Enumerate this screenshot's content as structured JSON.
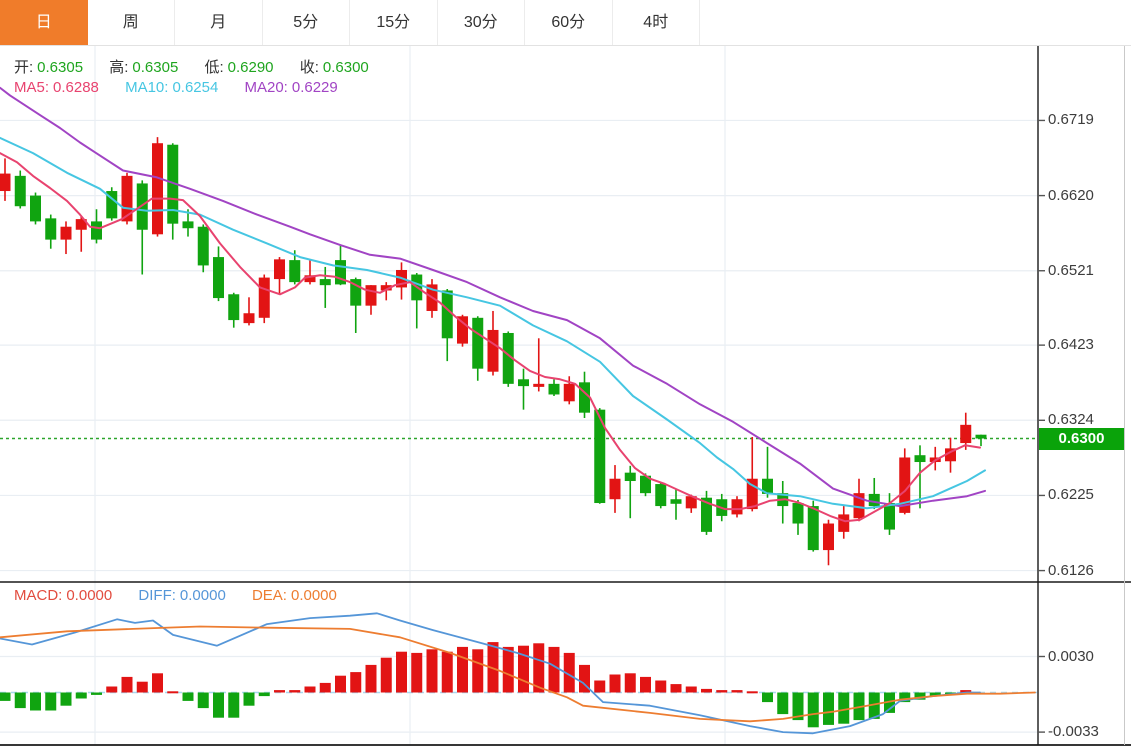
{
  "tabs": {
    "items": [
      {
        "key": "day",
        "label": "日",
        "active": true
      },
      {
        "key": "week",
        "label": "周",
        "active": false
      },
      {
        "key": "month",
        "label": "月",
        "active": false
      },
      {
        "key": "5min",
        "label": "5分",
        "active": false
      },
      {
        "key": "15min",
        "label": "15分",
        "active": false
      },
      {
        "key": "30min",
        "label": "30分",
        "active": false
      },
      {
        "key": "60min",
        "label": "60分",
        "active": false
      },
      {
        "key": "4hour",
        "label": "4时",
        "active": false
      }
    ]
  },
  "legend": {
    "open_label": "开:",
    "open": "0.6305",
    "high_label": "高:",
    "high": "0.6305",
    "low_label": "低:",
    "low": "0.6290",
    "close_label": "收:",
    "close": "0.6300",
    "ma5_label": "MA5:",
    "ma5": "0.6288",
    "ma10_label": "MA10:",
    "ma10": "0.6254",
    "ma20_label": "MA20:",
    "ma20": "0.6229"
  },
  "macd_legend": {
    "macd_label": "MACD:",
    "macd": "0.0000",
    "diff_label": "DIFF:",
    "diff": "0.0000",
    "dea_label": "DEA:",
    "dea": "0.0000"
  },
  "price_axis": {
    "ticks": [
      {
        "label": "0.6719",
        "value": 0.6719
      },
      {
        "label": "0.6620",
        "value": 0.662
      },
      {
        "label": "0.6521",
        "value": 0.6521
      },
      {
        "label": "0.6423",
        "value": 0.6423
      },
      {
        "label": "0.6324",
        "value": 0.6324
      },
      {
        "label": "0.6225",
        "value": 0.6225
      },
      {
        "label": "0.6126",
        "value": 0.6126
      }
    ],
    "current": "0.6300",
    "current_value": 0.63
  },
  "macd_axis": {
    "ticks": [
      {
        "label": "0.0030",
        "value": 0.003
      },
      {
        "label": "-0.0033",
        "value": -0.0033
      }
    ]
  },
  "colors": {
    "up": "#e21414",
    "down": "#10a410",
    "ma5": "#e8436f",
    "ma10": "#46c6e2",
    "ma20": "#a144c4",
    "diff": "#5596d8",
    "dea": "#ed7d31",
    "macd_text": "#e24c3f",
    "tab_accent": "#f07c2a",
    "badge": "#0aa30a",
    "value_green": "#1fa51f",
    "price_line": "#2ca52c",
    "zero_line": "#a8d8f0",
    "grid": "#e9eef3",
    "panel_border": "#1a1a1a",
    "axis_text": "#3c3c3c"
  },
  "chart_data": {
    "type": "candlestick",
    "panels": [
      "price",
      "macd"
    ],
    "convention": "red-up-green-down",
    "price_axis_range": [
      0.609,
      0.679
    ],
    "macd_axis_range": [
      -0.0044,
      0.0094
    ],
    "current_price": 0.63,
    "candles": [
      [
        0.6626,
        0.6669,
        0.6613,
        0.6649
      ],
      [
        0.6646,
        0.6653,
        0.6603,
        0.6606
      ],
      [
        0.662,
        0.6624,
        0.6582,
        0.6586
      ],
      [
        0.659,
        0.6595,
        0.655,
        0.6562
      ],
      [
        0.6562,
        0.6586,
        0.6543,
        0.6579
      ],
      [
        0.6575,
        0.6593,
        0.6546,
        0.6589
      ],
      [
        0.6586,
        0.6602,
        0.6557,
        0.6562
      ],
      [
        0.6626,
        0.6631,
        0.6587,
        0.659
      ],
      [
        0.6586,
        0.665,
        0.6582,
        0.6646
      ],
      [
        0.6636,
        0.664,
        0.6516,
        0.6575
      ],
      [
        0.6569,
        0.6697,
        0.6566,
        0.6689
      ],
      [
        0.6687,
        0.6689,
        0.6562,
        0.6583
      ],
      [
        0.6586,
        0.6602,
        0.6566,
        0.6577
      ],
      [
        0.6579,
        0.6582,
        0.6519,
        0.6528
      ],
      [
        0.6539,
        0.6553,
        0.6481,
        0.6485
      ],
      [
        0.649,
        0.6492,
        0.6446,
        0.6456
      ],
      [
        0.6452,
        0.6486,
        0.6449,
        0.6465
      ],
      [
        0.6459,
        0.6516,
        0.6452,
        0.6512
      ],
      [
        0.651,
        0.6539,
        0.649,
        0.6536
      ],
      [
        0.6535,
        0.6548,
        0.6503,
        0.6506
      ],
      [
        0.6506,
        0.6536,
        0.6503,
        0.6515
      ],
      [
        0.651,
        0.6526,
        0.6472,
        0.6502
      ],
      [
        0.6535,
        0.6555,
        0.6502,
        0.6503
      ],
      [
        0.651,
        0.6512,
        0.6439,
        0.6475
      ],
      [
        0.6475,
        0.6502,
        0.6463,
        0.6502
      ],
      [
        0.6495,
        0.6506,
        0.6482,
        0.6502
      ],
      [
        0.6499,
        0.6532,
        0.6483,
        0.6522
      ],
      [
        0.6516,
        0.6518,
        0.6445,
        0.6482
      ],
      [
        0.6468,
        0.651,
        0.6459,
        0.6503
      ],
      [
        0.6495,
        0.6497,
        0.6402,
        0.6432
      ],
      [
        0.6425,
        0.6463,
        0.6421,
        0.6461
      ],
      [
        0.6459,
        0.6461,
        0.6376,
        0.6392
      ],
      [
        0.6388,
        0.6468,
        0.6383,
        0.6443
      ],
      [
        0.6439,
        0.6441,
        0.6368,
        0.6372
      ],
      [
        0.6378,
        0.6392,
        0.6338,
        0.6369
      ],
      [
        0.6368,
        0.6432,
        0.6362,
        0.6372
      ],
      [
        0.6372,
        0.6378,
        0.6356,
        0.6358
      ],
      [
        0.6349,
        0.6382,
        0.6345,
        0.6372
      ],
      [
        0.6374,
        0.6388,
        0.6327,
        0.6334
      ],
      [
        0.6338,
        0.634,
        0.6214,
        0.6215
      ],
      [
        0.622,
        0.6265,
        0.6202,
        0.6247
      ],
      [
        0.6255,
        0.6264,
        0.6195,
        0.6244
      ],
      [
        0.6251,
        0.6254,
        0.6224,
        0.6228
      ],
      [
        0.624,
        0.6242,
        0.6208,
        0.6211
      ],
      [
        0.622,
        0.6234,
        0.6193,
        0.6214
      ],
      [
        0.6208,
        0.6226,
        0.6202,
        0.6224
      ],
      [
        0.6222,
        0.6231,
        0.6173,
        0.6177
      ],
      [
        0.622,
        0.6227,
        0.6191,
        0.6198
      ],
      [
        0.62,
        0.6224,
        0.6196,
        0.622
      ],
      [
        0.6207,
        0.6302,
        0.6204,
        0.6247
      ],
      [
        0.6247,
        0.6289,
        0.6222,
        0.6227
      ],
      [
        0.6228,
        0.6244,
        0.6188,
        0.6211
      ],
      [
        0.6215,
        0.6219,
        0.6173,
        0.6188
      ],
      [
        0.6211,
        0.6218,
        0.6151,
        0.6153
      ],
      [
        0.6153,
        0.6193,
        0.6133,
        0.6188
      ],
      [
        0.6177,
        0.6211,
        0.6168,
        0.62
      ],
      [
        0.6195,
        0.6247,
        0.6191,
        0.6228
      ],
      [
        0.6227,
        0.6248,
        0.6207,
        0.6211
      ],
      [
        0.6215,
        0.6228,
        0.6173,
        0.618
      ],
      [
        0.6202,
        0.6287,
        0.62,
        0.6275
      ],
      [
        0.6278,
        0.6291,
        0.6208,
        0.6269
      ],
      [
        0.6269,
        0.6289,
        0.6258,
        0.6275
      ],
      [
        0.627,
        0.6301,
        0.6255,
        0.6287
      ],
      [
        0.6294,
        0.6334,
        0.6285,
        0.6318
      ],
      [
        0.6305,
        0.6305,
        0.629,
        0.63
      ]
    ],
    "ma5_points": [
      [
        0,
        0.6676
      ],
      [
        17,
        0.6664
      ],
      [
        33,
        0.6646
      ],
      [
        50,
        0.663
      ],
      [
        67,
        0.6613
      ],
      [
        80,
        0.6595
      ],
      [
        90,
        0.6579
      ],
      [
        100,
        0.6577
      ],
      [
        122,
        0.6589
      ],
      [
        152,
        0.6616
      ],
      [
        170,
        0.6616
      ],
      [
        183,
        0.6614
      ],
      [
        200,
        0.6593
      ],
      [
        220,
        0.6557
      ],
      [
        240,
        0.6526
      ],
      [
        260,
        0.6499
      ],
      [
        280,
        0.649
      ],
      [
        295,
        0.6499
      ],
      [
        305,
        0.6512
      ],
      [
        320,
        0.6515
      ],
      [
        335,
        0.6513
      ],
      [
        350,
        0.6506
      ],
      [
        365,
        0.6496
      ],
      [
        380,
        0.6492
      ],
      [
        395,
        0.6502
      ],
      [
        410,
        0.6506
      ],
      [
        425,
        0.6492
      ],
      [
        440,
        0.6479
      ],
      [
        455,
        0.6461
      ],
      [
        470,
        0.6445
      ],
      [
        485,
        0.6432
      ],
      [
        500,
        0.6419
      ],
      [
        515,
        0.6403
      ],
      [
        530,
        0.6389
      ],
      [
        545,
        0.6381
      ],
      [
        560,
        0.6378
      ],
      [
        575,
        0.6372
      ],
      [
        590,
        0.6354
      ],
      [
        605,
        0.6314
      ],
      [
        620,
        0.6285
      ],
      [
        635,
        0.6261
      ],
      [
        650,
        0.6247
      ],
      [
        665,
        0.624
      ],
      [
        680,
        0.6231
      ],
      [
        695,
        0.6222
      ],
      [
        710,
        0.6214
      ],
      [
        725,
        0.6207
      ],
      [
        740,
        0.6207
      ],
      [
        755,
        0.6211
      ],
      [
        770,
        0.6218
      ],
      [
        785,
        0.622
      ],
      [
        800,
        0.6215
      ],
      [
        815,
        0.6207
      ],
      [
        830,
        0.6198
      ],
      [
        845,
        0.6191
      ],
      [
        860,
        0.6193
      ],
      [
        875,
        0.6204
      ],
      [
        890,
        0.6215
      ],
      [
        905,
        0.6231
      ],
      [
        920,
        0.6255
      ],
      [
        935,
        0.6271
      ],
      [
        950,
        0.6282
      ],
      [
        965,
        0.6291
      ],
      [
        980,
        0.6288
      ]
    ],
    "ma10_points": [
      [
        0,
        0.6696
      ],
      [
        33,
        0.6676
      ],
      [
        67,
        0.665
      ],
      [
        100,
        0.6629
      ],
      [
        123,
        0.6604
      ],
      [
        147,
        0.66
      ],
      [
        173,
        0.6601
      ],
      [
        200,
        0.6595
      ],
      [
        233,
        0.6575
      ],
      [
        267,
        0.6557
      ],
      [
        300,
        0.6539
      ],
      [
        333,
        0.6528
      ],
      [
        367,
        0.6522
      ],
      [
        400,
        0.6512
      ],
      [
        433,
        0.6496
      ],
      [
        467,
        0.6486
      ],
      [
        500,
        0.6475
      ],
      [
        533,
        0.6449
      ],
      [
        567,
        0.6428
      ],
      [
        600,
        0.6401
      ],
      [
        633,
        0.6356
      ],
      [
        667,
        0.6325
      ],
      [
        700,
        0.6294
      ],
      [
        717,
        0.6275
      ],
      [
        733,
        0.626
      ],
      [
        750,
        0.624
      ],
      [
        767,
        0.6228
      ],
      [
        800,
        0.6224
      ],
      [
        833,
        0.6214
      ],
      [
        867,
        0.6208
      ],
      [
        900,
        0.6214
      ],
      [
        933,
        0.6224
      ],
      [
        950,
        0.6234
      ],
      [
        967,
        0.6244
      ],
      [
        985,
        0.6258
      ]
    ],
    "ma20_points": [
      [
        0,
        0.6762
      ],
      [
        10,
        0.6752
      ],
      [
        40,
        0.6726
      ],
      [
        60,
        0.6709
      ],
      [
        80,
        0.669
      ],
      [
        95,
        0.6677
      ],
      [
        123,
        0.6653
      ],
      [
        157,
        0.6644
      ],
      [
        190,
        0.6629
      ],
      [
        223,
        0.6613
      ],
      [
        257,
        0.6595
      ],
      [
        290,
        0.6579
      ],
      [
        310,
        0.6569
      ],
      [
        340,
        0.6555
      ],
      [
        370,
        0.6542
      ],
      [
        400,
        0.6537
      ],
      [
        433,
        0.6522
      ],
      [
        467,
        0.6506
      ],
      [
        500,
        0.6486
      ],
      [
        533,
        0.6468
      ],
      [
        567,
        0.6456
      ],
      [
        600,
        0.6432
      ],
      [
        633,
        0.6396
      ],
      [
        667,
        0.6372
      ],
      [
        700,
        0.6345
      ],
      [
        733,
        0.6322
      ],
      [
        767,
        0.6294
      ],
      [
        800,
        0.6267
      ],
      [
        833,
        0.6234
      ],
      [
        867,
        0.6218
      ],
      [
        900,
        0.6211
      ],
      [
        933,
        0.6218
      ],
      [
        967,
        0.6224
      ],
      [
        985,
        0.6231
      ]
    ],
    "macd_hist": [
      -0.0007,
      -0.0013,
      -0.0015,
      -0.0015,
      -0.0011,
      -0.0005,
      -0.0002,
      0.0005,
      0.0013,
      0.0009,
      0.0016,
      0.0001,
      -0.0007,
      -0.0013,
      -0.0021,
      -0.0021,
      -0.0011,
      -0.0003,
      0.0002,
      0.0002,
      0.0005,
      0.0008,
      0.0014,
      0.0017,
      0.0023,
      0.0029,
      0.0034,
      0.0033,
      0.0036,
      0.0034,
      0.0038,
      0.0036,
      0.0042,
      0.0038,
      0.0039,
      0.0041,
      0.0038,
      0.0033,
      0.0023,
      0.001,
      0.0015,
      0.0016,
      0.0013,
      0.001,
      0.0007,
      0.0005,
      0.0003,
      0.0002,
      0.0002,
      0.0001,
      -0.0008,
      -0.0018,
      -0.0023,
      -0.0029,
      -0.0027,
      -0.0026,
      -0.0023,
      -0.0022,
      -0.0017,
      -0.0008,
      -0.0006,
      -0.0003,
      -0.0001,
      0.0002,
      0.0
    ],
    "diff_points": [
      [
        0,
        0.0045
      ],
      [
        32,
        0.004
      ],
      [
        75,
        0.005
      ],
      [
        117,
        0.0061
      ],
      [
        135,
        0.0058
      ],
      [
        153,
        0.006
      ],
      [
        173,
        0.0048
      ],
      [
        217,
        0.0039
      ],
      [
        267,
        0.0057
      ],
      [
        310,
        0.0062
      ],
      [
        350,
        0.0064
      ],
      [
        377,
        0.0066
      ],
      [
        400,
        0.006
      ],
      [
        433,
        0.0052
      ],
      [
        482,
        0.0041
      ],
      [
        517,
        0.0033
      ],
      [
        550,
        0.0024
      ],
      [
        583,
        0.0008
      ],
      [
        603,
        -0.0008
      ],
      [
        650,
        -0.0011
      ],
      [
        700,
        -0.0019
      ],
      [
        750,
        -0.0028
      ],
      [
        783,
        -0.0033
      ],
      [
        813,
        -0.0034
      ],
      [
        850,
        -0.0028
      ],
      [
        883,
        -0.0018
      ],
      [
        900,
        -0.0007
      ],
      [
        933,
        -0.0003
      ],
      [
        967,
        0.0
      ],
      [
        980,
        0.0
      ]
    ],
    "dea_points": [
      [
        0,
        0.0046
      ],
      [
        67,
        0.0051
      ],
      [
        133,
        0.0053
      ],
      [
        200,
        0.0055
      ],
      [
        267,
        0.0054
      ],
      [
        350,
        0.0053
      ],
      [
        400,
        0.0046
      ],
      [
        450,
        0.0033
      ],
      [
        500,
        0.0018
      ],
      [
        540,
        0.0004
      ],
      [
        567,
        -0.0004
      ],
      [
        583,
        -0.0011
      ],
      [
        650,
        -0.0017
      ],
      [
        700,
        -0.0022
      ],
      [
        750,
        -0.0024
      ],
      [
        783,
        -0.0022
      ],
      [
        813,
        -0.0018
      ],
      [
        833,
        -0.0016
      ],
      [
        867,
        -0.0011
      ],
      [
        900,
        -0.0006
      ],
      [
        933,
        -0.0003
      ],
      [
        967,
        -0.0001
      ],
      [
        1000,
        -0.0001
      ],
      [
        1035,
        0.0
      ]
    ]
  }
}
